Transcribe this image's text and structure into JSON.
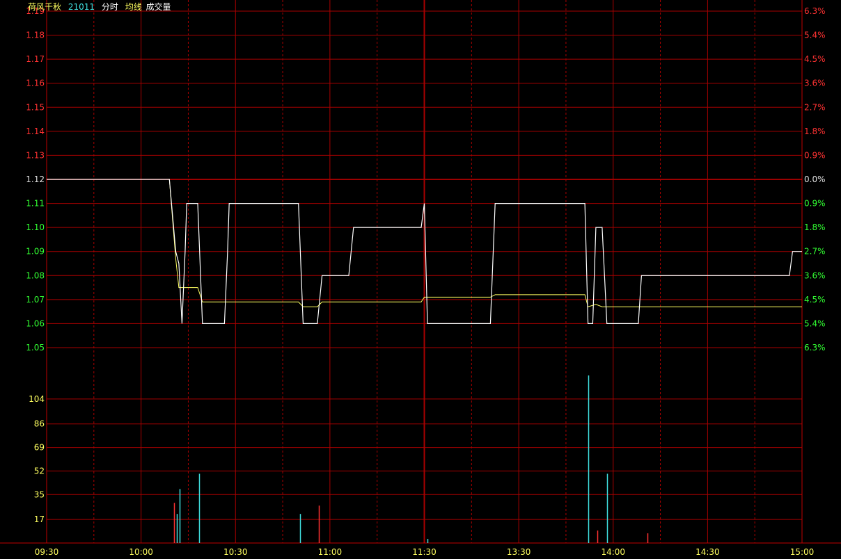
{
  "header": {
    "name": "荷风千秋",
    "code": "21011",
    "mode": "分时",
    "avg_label": "均线",
    "vol_label": "成交量"
  },
  "colors": {
    "background": "#000000",
    "grid": "#a80000",
    "axis_frame": "#c00000",
    "up": "#ff3232",
    "down": "#32ff32",
    "flat": "#e0e0e0",
    "price_line": "#ffffff",
    "avg_line": "#ffff60",
    "vol_axis_text": "#ffff60",
    "vol_up": "#ff3232",
    "vol_down": "#40e0e0",
    "time_text": "#ffff60",
    "name_text": "#ffff60",
    "code_text": "#40e0e0"
  },
  "chart_data": {
    "type": "line",
    "prev_close": 1.12,
    "price_ticks": [
      "1.19",
      "1.18",
      "1.17",
      "1.16",
      "1.15",
      "1.14",
      "1.13",
      "1.12",
      "1.11",
      "1.10",
      "1.09",
      "1.08",
      "1.07",
      "1.06",
      "1.05"
    ],
    "pct_ticks": [
      "6.3%",
      "5.4%",
      "4.5%",
      "3.6%",
      "2.7%",
      "1.8%",
      "0.9%",
      "0.0%",
      "0.9%",
      "1.8%",
      "2.7%",
      "3.6%",
      "4.5%",
      "5.4%",
      "6.3%"
    ],
    "ylim": [
      1.05,
      1.19
    ],
    "volume_ticks": [
      "104",
      "86",
      "69",
      "52",
      "35",
      "17"
    ],
    "volume_ylim": [
      0,
      121
    ],
    "time_ticks": [
      "09:30",
      "10:00",
      "10:30",
      "11:00",
      "11:30",
      "13:30",
      "14:00",
      "14:30",
      "15:00"
    ],
    "xlim": [
      0,
      240
    ],
    "series": [
      {
        "name": "分时",
        "points": [
          [
            0,
            1.12
          ],
          [
            39,
            1.12
          ],
          [
            41,
            1.09
          ],
          [
            42,
            1.085
          ],
          [
            43,
            1.06
          ],
          [
            44,
            1.09
          ],
          [
            44.5,
            1.11
          ],
          [
            48,
            1.11
          ],
          [
            49.5,
            1.06
          ],
          [
            56.5,
            1.06
          ],
          [
            57.5,
            1.09
          ],
          [
            58,
            1.11
          ],
          [
            80,
            1.11
          ],
          [
            81.5,
            1.06
          ],
          [
            86,
            1.06
          ],
          [
            87.5,
            1.08
          ],
          [
            96,
            1.08
          ],
          [
            97.5,
            1.1
          ],
          [
            119,
            1.1
          ],
          [
            120,
            1.11
          ],
          [
            121,
            1.06
          ],
          [
            141,
            1.06
          ],
          [
            142.5,
            1.11
          ],
          [
            171,
            1.11
          ],
          [
            172,
            1.06
          ],
          [
            173.5,
            1.06
          ],
          [
            174.5,
            1.1
          ],
          [
            176.5,
            1.1
          ],
          [
            178,
            1.06
          ],
          [
            188,
            1.06
          ],
          [
            189,
            1.08
          ],
          [
            236,
            1.08
          ],
          [
            237,
            1.09
          ],
          [
            240,
            1.09
          ]
        ]
      },
      {
        "name": "均线",
        "points": [
          [
            0,
            1.12
          ],
          [
            39,
            1.12
          ],
          [
            41,
            1.087
          ],
          [
            42,
            1.075
          ],
          [
            48,
            1.075
          ],
          [
            49.5,
            1.069
          ],
          [
            80,
            1.069
          ],
          [
            81.5,
            1.067
          ],
          [
            86,
            1.067
          ],
          [
            87.5,
            1.069
          ],
          [
            119,
            1.069
          ],
          [
            120,
            1.071
          ],
          [
            141,
            1.071
          ],
          [
            142.5,
            1.072
          ],
          [
            171,
            1.072
          ],
          [
            172,
            1.067
          ],
          [
            174.5,
            1.068
          ],
          [
            176.5,
            1.067
          ],
          [
            240,
            1.067
          ]
        ]
      }
    ],
    "volume": [
      {
        "t": 40.5,
        "v": 29,
        "dir": "up"
      },
      {
        "t": 41.3,
        "v": 21,
        "dir": "down"
      },
      {
        "t": 42.3,
        "v": 39,
        "dir": "down"
      },
      {
        "t": 48.5,
        "v": 50,
        "dir": "down"
      },
      {
        "t": 80.5,
        "v": 21,
        "dir": "down"
      },
      {
        "t": 86.5,
        "v": 27,
        "dir": "up"
      },
      {
        "t": 121,
        "v": 3,
        "dir": "down"
      },
      {
        "t": 172,
        "v": 121,
        "dir": "down"
      },
      {
        "t": 175,
        "v": 9,
        "dir": "up"
      },
      {
        "t": 178,
        "v": 50,
        "dir": "down"
      },
      {
        "t": 191,
        "v": 7,
        "dir": "up"
      }
    ]
  }
}
